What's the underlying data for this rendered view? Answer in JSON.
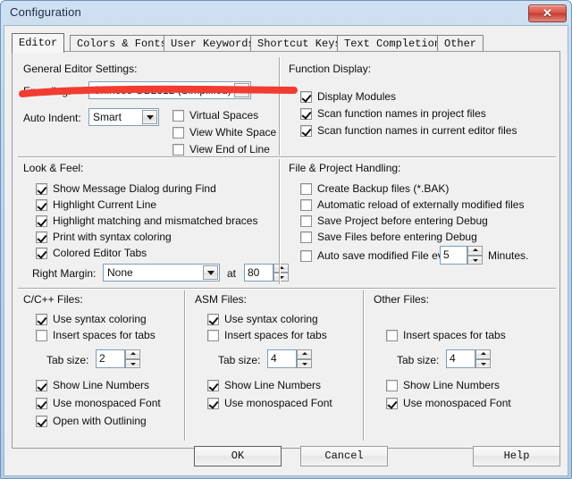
{
  "window": {
    "title": "Configuration",
    "close_icon": "close-icon",
    "close_label": "✕"
  },
  "tabs": [
    {
      "label": "Editor",
      "active": true
    },
    {
      "label": "Colors & Fonts",
      "active": false
    },
    {
      "label": "User Keywords",
      "active": false
    },
    {
      "label": "Shortcut Keys",
      "active": false
    },
    {
      "label": "Text Completion",
      "active": false
    },
    {
      "label": "Other",
      "active": false
    }
  ],
  "general_editor_settings": {
    "title": "General Editor Settings:",
    "encoding_label": "Encoding:",
    "encoding_value": "Chinese GB2312 (Simplified)",
    "auto_indent_label": "Auto Indent:",
    "auto_indent_value": "Smart",
    "checkboxes": [
      {
        "label": "Virtual Spaces",
        "checked": false
      },
      {
        "label": "View White Space",
        "checked": false
      },
      {
        "label": "View End of Line",
        "checked": false
      }
    ]
  },
  "function_display": {
    "title": "Function Display:",
    "checkboxes": [
      {
        "label": "Display Modules",
        "checked": true
      },
      {
        "label": "Scan function names in project files",
        "checked": true
      },
      {
        "label": "Scan function names in current editor files",
        "checked": true
      }
    ]
  },
  "look_and_feel": {
    "title": "Look & Feel:",
    "checkboxes": [
      {
        "label": "Show Message Dialog during Find",
        "checked": true
      },
      {
        "label": "Highlight Current Line",
        "checked": true
      },
      {
        "label": "Highlight matching and mismatched braces",
        "checked": true
      },
      {
        "label": "Print with syntax coloring",
        "checked": true
      },
      {
        "label": "Colored Editor Tabs",
        "checked": true
      }
    ],
    "right_margin_label": "Right Margin:",
    "right_margin_value": "None",
    "at_label": "at",
    "at_value": "80"
  },
  "file_project_handling": {
    "title": "File & Project Handling:",
    "checkboxes": [
      {
        "label": "Create Backup files (*.BAK)",
        "checked": false
      },
      {
        "label": "Automatic reload of externally modified files",
        "checked": false
      },
      {
        "label": "Save Project before entering Debug",
        "checked": false
      },
      {
        "label": "Save Files before entering Debug",
        "checked": false
      },
      {
        "label": "Auto save modified File every",
        "checked": false
      }
    ],
    "auto_save_value": "5",
    "minutes_label": "Minutes."
  },
  "c_files": {
    "title": "C/C++ Files:",
    "syntax_coloring": {
      "label": "Use syntax coloring",
      "checked": true
    },
    "insert_spaces": {
      "label": "Insert spaces for tabs",
      "checked": false
    },
    "tab_size_label": "Tab size:",
    "tab_size_value": "2",
    "line_numbers": {
      "label": "Show Line Numbers",
      "checked": true
    },
    "monospaced": {
      "label": "Use monospaced Font",
      "checked": true
    },
    "outlining": {
      "label": "Open with Outlining",
      "checked": true
    }
  },
  "asm_files": {
    "title": "ASM Files:",
    "syntax_coloring": {
      "label": "Use syntax coloring",
      "checked": true
    },
    "insert_spaces": {
      "label": "Insert spaces for tabs",
      "checked": false
    },
    "tab_size_label": "Tab size:",
    "tab_size_value": "4",
    "line_numbers": {
      "label": "Show Line Numbers",
      "checked": true
    },
    "monospaced": {
      "label": "Use monospaced Font",
      "checked": true
    }
  },
  "other_files": {
    "title": "Other Files:",
    "insert_spaces": {
      "label": "Insert spaces for tabs",
      "checked": false
    },
    "tab_size_label": "Tab size:",
    "tab_size_value": "4",
    "line_numbers": {
      "label": "Show Line Numbers",
      "checked": false
    },
    "monospaced": {
      "label": "Use monospaced Font",
      "checked": true
    }
  },
  "buttons": {
    "ok": "OK",
    "cancel": "Cancel",
    "help": "Help"
  },
  "annotation": {
    "color": "#f23c32",
    "shape": "underline-stroke"
  }
}
